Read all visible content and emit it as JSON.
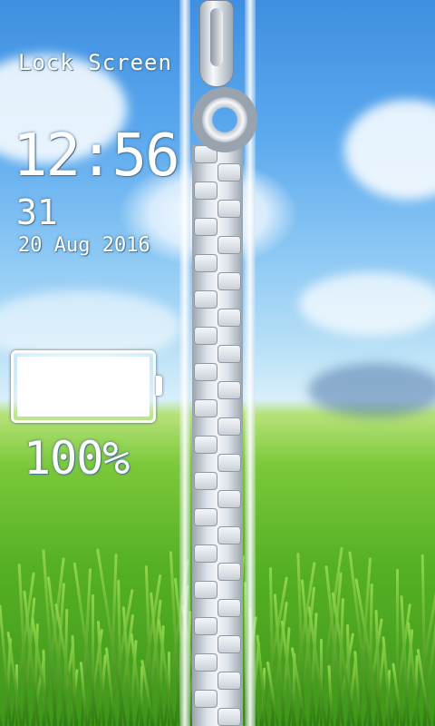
{
  "lock_screen": {
    "title": "Lock Screen",
    "time": "12:56",
    "day_of_month": "31",
    "date": "20 Aug 2016",
    "battery": {
      "level_fraction": 1.0,
      "label": "100%"
    }
  },
  "colors": {
    "text": "#ffffff",
    "text_shadow": "#3b6a92",
    "zipper_metal": "#c9d0d8"
  },
  "icons": {
    "battery": "battery-icon",
    "zipper_pull": "zipper-pull-icon"
  }
}
